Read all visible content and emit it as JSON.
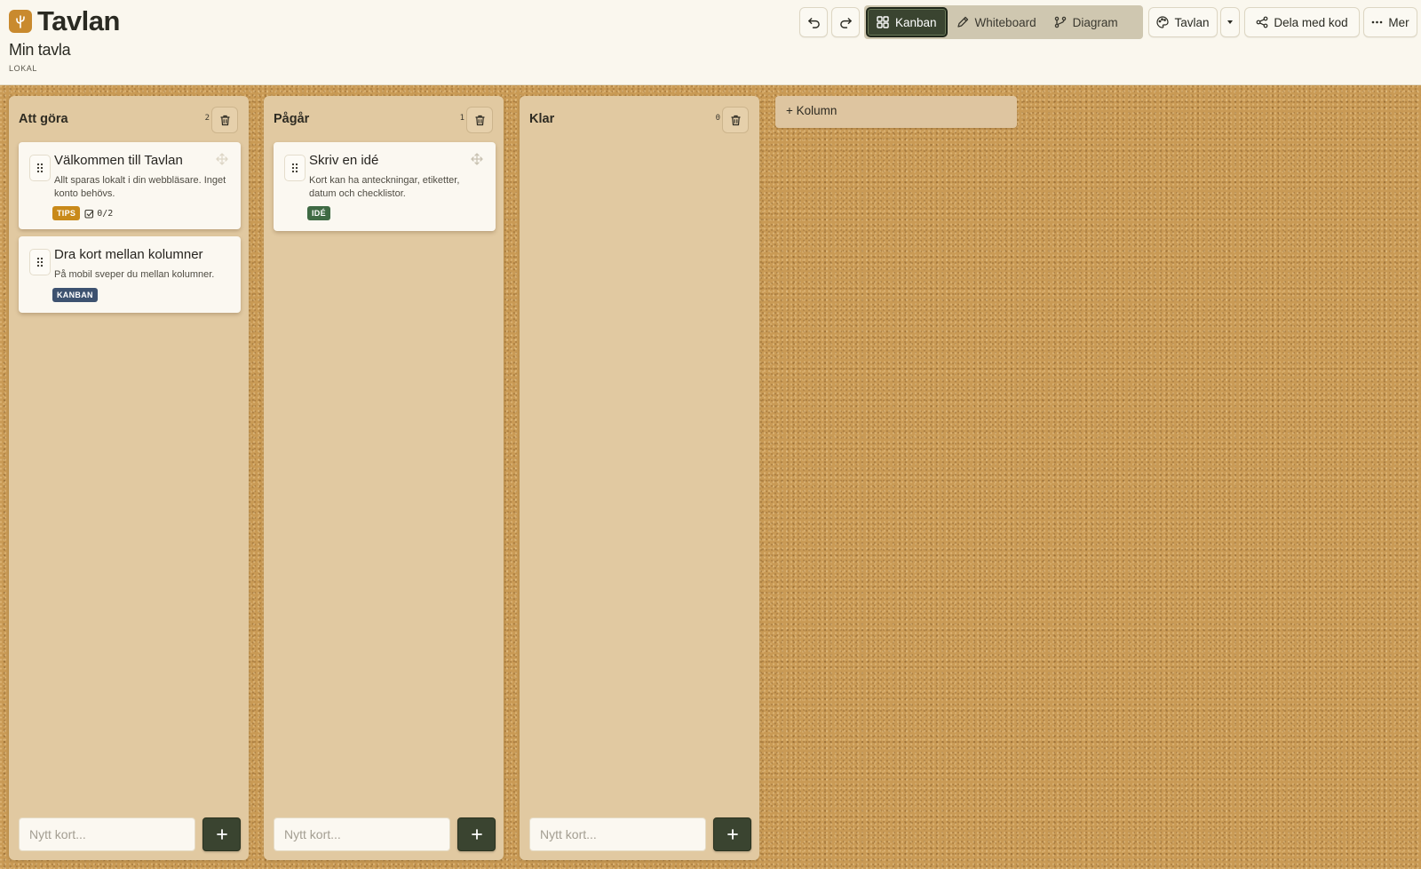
{
  "app": {
    "title": "Tavlan"
  },
  "board": {
    "title": "Min tavla",
    "storage": "LOKAL"
  },
  "toolbar": {
    "views": [
      {
        "label": "Kanban"
      },
      {
        "label": "Whiteboard"
      },
      {
        "label": "Diagram"
      }
    ],
    "theme_label": "Tavlan",
    "share_label": "Dela med kod",
    "more_label": "Mer"
  },
  "columns": [
    {
      "title": "Att göra",
      "count": "2",
      "cards": [
        {
          "title": "Välkommen till Tavlan",
          "desc": "Allt sparas lokalt i din webbläsare. Inget konto behövs.",
          "tag": "TIPS",
          "tag_color": "#c98a1a",
          "checklist": "0/2"
        },
        {
          "title": "Dra kort mellan kolumner",
          "desc": "På mobil sveper du mellan kolumner.",
          "tag": "KANBAN",
          "tag_color": "#3d5270"
        }
      ]
    },
    {
      "title": "Pågår",
      "count": "1",
      "cards": [
        {
          "title": "Skriv en idé",
          "desc": "Kort kan ha anteckningar, etiketter, datum och checklistor.",
          "tag": "IDÉ",
          "tag_color": "#3f6a44"
        }
      ]
    },
    {
      "title": "Klar",
      "count": "0",
      "cards": []
    }
  ],
  "new_card_placeholder": "Nytt kort...",
  "add_column_label": "+ Kolumn",
  "colors": {
    "accent": "#3a4430",
    "cork": "#c99a55",
    "logo": "#c98a2e"
  }
}
